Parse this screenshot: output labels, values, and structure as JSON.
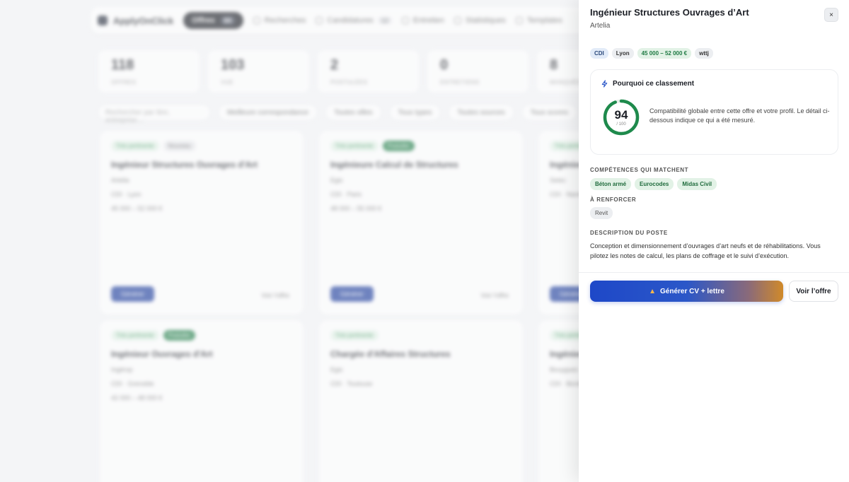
{
  "background": {
    "brand": "ApplyOnClick",
    "nav": {
      "active": "Offres",
      "active_count": "64",
      "items": [
        "Recherches",
        "Candidatures",
        "Entretien",
        "Statistiques",
        "Templates"
      ],
      "candidatures_count": "12"
    },
    "stats": [
      {
        "value": "118",
        "label": "OFFRES"
      },
      {
        "value": "103",
        "label": "VUE"
      },
      {
        "value": "2",
        "label": "POSTULÉES"
      },
      {
        "value": "0",
        "label": "ENTRETIENS"
      },
      {
        "value": "8",
        "label": "MANQUÉES"
      }
    ],
    "filters": {
      "search_placeholder": "Rechercher par titre, entreprise…",
      "chips": [
        "Meilleure correspondance",
        "Toutes villes",
        "Tous types",
        "Toutes sources",
        "Tous scores"
      ]
    },
    "cards": [
      {
        "tags": [
          "Très pertinente",
          "Nouveau"
        ],
        "title": "Ingénieur Structures Ouvrages d'Art",
        "company": "Artelia",
        "meta": "CDI · Lyon",
        "salary": "45 000 – 52 000 €",
        "button": "Générer",
        "more": "Voir l'offre"
      },
      {
        "tags": [
          "Très pertinente",
          "Postulée"
        ],
        "title": "Ingénieure Calcul de Structures",
        "company": "Egis",
        "meta": "CDI · Paris",
        "salary": "48 000 – 55 000 €",
        "button": "Générer",
        "more": "Voir l'offre"
      },
      {
        "tags": [
          "Très pertinente"
        ],
        "title": "Ingénieur Structures Bâtiment",
        "company": "Setec",
        "meta": "CDI · Nantes",
        "salary": "",
        "button": "Générer",
        "more": ""
      },
      {
        "tags": [
          "Très pertinente",
          "Postulée"
        ],
        "title": "Ingénieur Ouvrages d'Art",
        "company": "Ingérop",
        "meta": "CDI · Grenoble",
        "salary": "42 000 – 48 000 €",
        "button": "",
        "more": ""
      },
      {
        "tags": [
          "Très pertinente"
        ],
        "title": "Chargée d'Affaires Structures",
        "company": "Egis",
        "meta": "CDI · Toulouse",
        "salary": "",
        "button": "",
        "more": ""
      },
      {
        "tags": [
          "Très pertinente"
        ],
        "title": "Ingénieur Structures",
        "company": "Bouygues",
        "meta": "CDI · Bordeaux",
        "salary": "",
        "button": "",
        "more": ""
      }
    ]
  },
  "drawer": {
    "title": "Ingénieur Structures Ouvrages d’Art",
    "company": "Artelia",
    "close_label": "×",
    "tags": [
      "CDI",
      "Lyon",
      "45 000 – 52 000 €",
      "wttj"
    ],
    "ranking": {
      "heading": "Pourquoi ce classement",
      "score": "94",
      "score_max": "/ 100",
      "score_value": 94,
      "description": "Compatibilité globale entre cette offre et votre profil. Le détail ci-dessous indique ce qui a été mesuré."
    },
    "skills_match_heading": "Compétences qui matchent",
    "skills_match": [
      "Béton armé",
      "Eurocodes",
      "Midas Civil"
    ],
    "skills_improve_heading": "À renforcer",
    "skills_improve": [
      "Revit"
    ],
    "description_heading": "Description du poste",
    "description": "Conception et dimensionnement d’ouvrages d’art neufs et de réhabilitations. Vous pilotez les notes de calcul, les plans de coffrage et le suivi d’exécution.",
    "cta_label": "Générer CV + lettre",
    "secondary_label": "Voir l’offre",
    "colors": {
      "accent": "#1e48c8",
      "gauge": "#1e8a4c",
      "gradient_end": "#d08a2a"
    }
  }
}
